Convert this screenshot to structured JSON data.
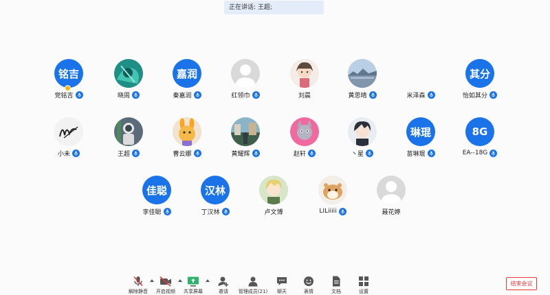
{
  "speaking_banner": {
    "text": "正在讲话: 王超;"
  },
  "participants": [
    {
      "name": "党铭吉",
      "avatar_type": "text",
      "avatar_text": "铭吉",
      "mic": true,
      "host": true
    },
    {
      "name": "晓周",
      "avatar_type": "image",
      "image": "teal-abstract",
      "mic": true
    },
    {
      "name": "秦嘉润",
      "avatar_type": "text",
      "avatar_text": "嘉润",
      "mic": true
    },
    {
      "name": "红领巾",
      "avatar_type": "image",
      "image": "default-user",
      "mic": true
    },
    {
      "name": "刘晨",
      "avatar_type": "image",
      "image": "anime-girl",
      "mic": false
    },
    {
      "name": "黄思晴",
      "avatar_type": "image",
      "image": "blue-sky",
      "mic": true
    },
    {
      "name": "米泽森",
      "avatar_type": "none",
      "mic": true
    },
    {
      "name": "怡如其分",
      "avatar_type": "text",
      "avatar_text": "其分",
      "mic": true
    },
    {
      "name": "小未",
      "avatar_type": "image",
      "image": "signature",
      "mic": true
    },
    {
      "name": "王超",
      "avatar_type": "image",
      "image": "astronaut",
      "mic": true
    },
    {
      "name": "曹云娜",
      "avatar_type": "image",
      "image": "cartoon-rabbit",
      "mic": true
    },
    {
      "name": "黄耀辉",
      "avatar_type": "image",
      "image": "street-photo",
      "mic": true
    },
    {
      "name": "赵轩",
      "avatar_type": "image",
      "image": "pink-cat",
      "mic": true
    },
    {
      "name": "丶星",
      "avatar_type": "image",
      "image": "anime-boy",
      "mic": true
    },
    {
      "name": "苗琳琨",
      "avatar_type": "text",
      "avatar_text": "琳琨",
      "mic": true
    },
    {
      "name": "EA--18G",
      "avatar_type": "text",
      "avatar_text": "8G",
      "mic": true
    },
    {
      "name": "李佳聪",
      "avatar_type": "text",
      "avatar_text": "佳聪",
      "mic": true
    },
    {
      "name": "丁汉林",
      "avatar_type": "text",
      "avatar_text": "汉林",
      "mic": true
    },
    {
      "name": "卢文博",
      "avatar_type": "image",
      "image": "anime-blond",
      "mic": false
    },
    {
      "name": "LILiiiii",
      "avatar_type": "image",
      "image": "hamster",
      "mic": true
    },
    {
      "name": "聂花婷",
      "avatar_type": "image",
      "image": "default-user",
      "mic": false
    }
  ],
  "toolbar": {
    "items": [
      {
        "label": "解除静音",
        "icon": "mic-muted-icon"
      },
      {
        "label": "开启视频",
        "icon": "video-off-icon"
      },
      {
        "label": "共享屏幕",
        "icon": "share-screen-icon"
      },
      {
        "label": "邀请",
        "icon": "invite-icon"
      },
      {
        "label": "管理成员(21)",
        "icon": "members-icon"
      },
      {
        "label": "聊天",
        "icon": "chat-icon"
      },
      {
        "label": "表情",
        "icon": "emoji-icon"
      },
      {
        "label": "文档",
        "icon": "document-icon"
      },
      {
        "label": "设置",
        "icon": "settings-icon"
      }
    ],
    "end_meeting_label": "结束会议"
  },
  "colors": {
    "accent": "#1a73e8",
    "end_button": "#e53935",
    "banner_bg": "#e3ecf8",
    "muted_red": "#e53935",
    "share_green": "#2fb36b"
  }
}
